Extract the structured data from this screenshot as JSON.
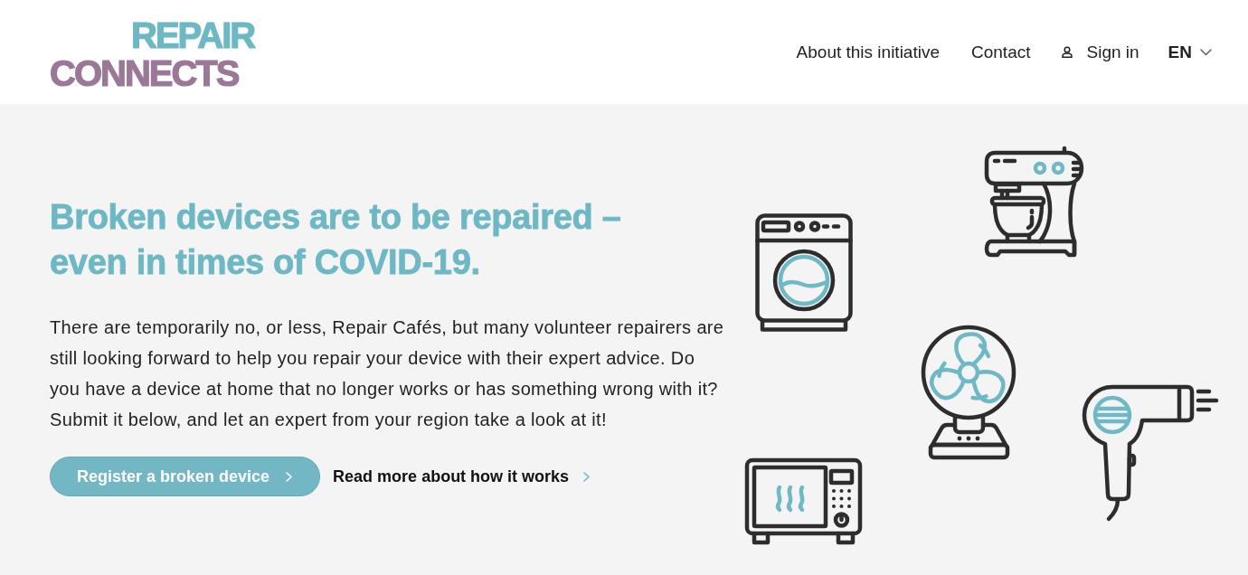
{
  "header": {
    "logo": {
      "line_1": "REPAIR",
      "line_2": "CONNECTS"
    },
    "nav": [
      {
        "label": "About this initiative",
        "kind": "link"
      },
      {
        "label": "Contact",
        "kind": "link"
      },
      {
        "label": "Sign in",
        "kind": "account"
      }
    ],
    "language": {
      "label": "EN"
    }
  },
  "hero": {
    "title": "Broken devices are to be repaired – even in times of COVID-19.",
    "text": "There are temporarily no, or less, Repair Cafés, but many volunteer repairers are still looking forward to help you repair your device with their expert advice. Do you have a device at home that no longer works or has something wrong with it? Submit it below, and let an expert from your region take a look at it!",
    "actions": [
      {
        "label": "Register a broken device",
        "kind": "primary"
      },
      {
        "label": "Read more about how it works",
        "kind": "secondary"
      }
    ]
  }
}
